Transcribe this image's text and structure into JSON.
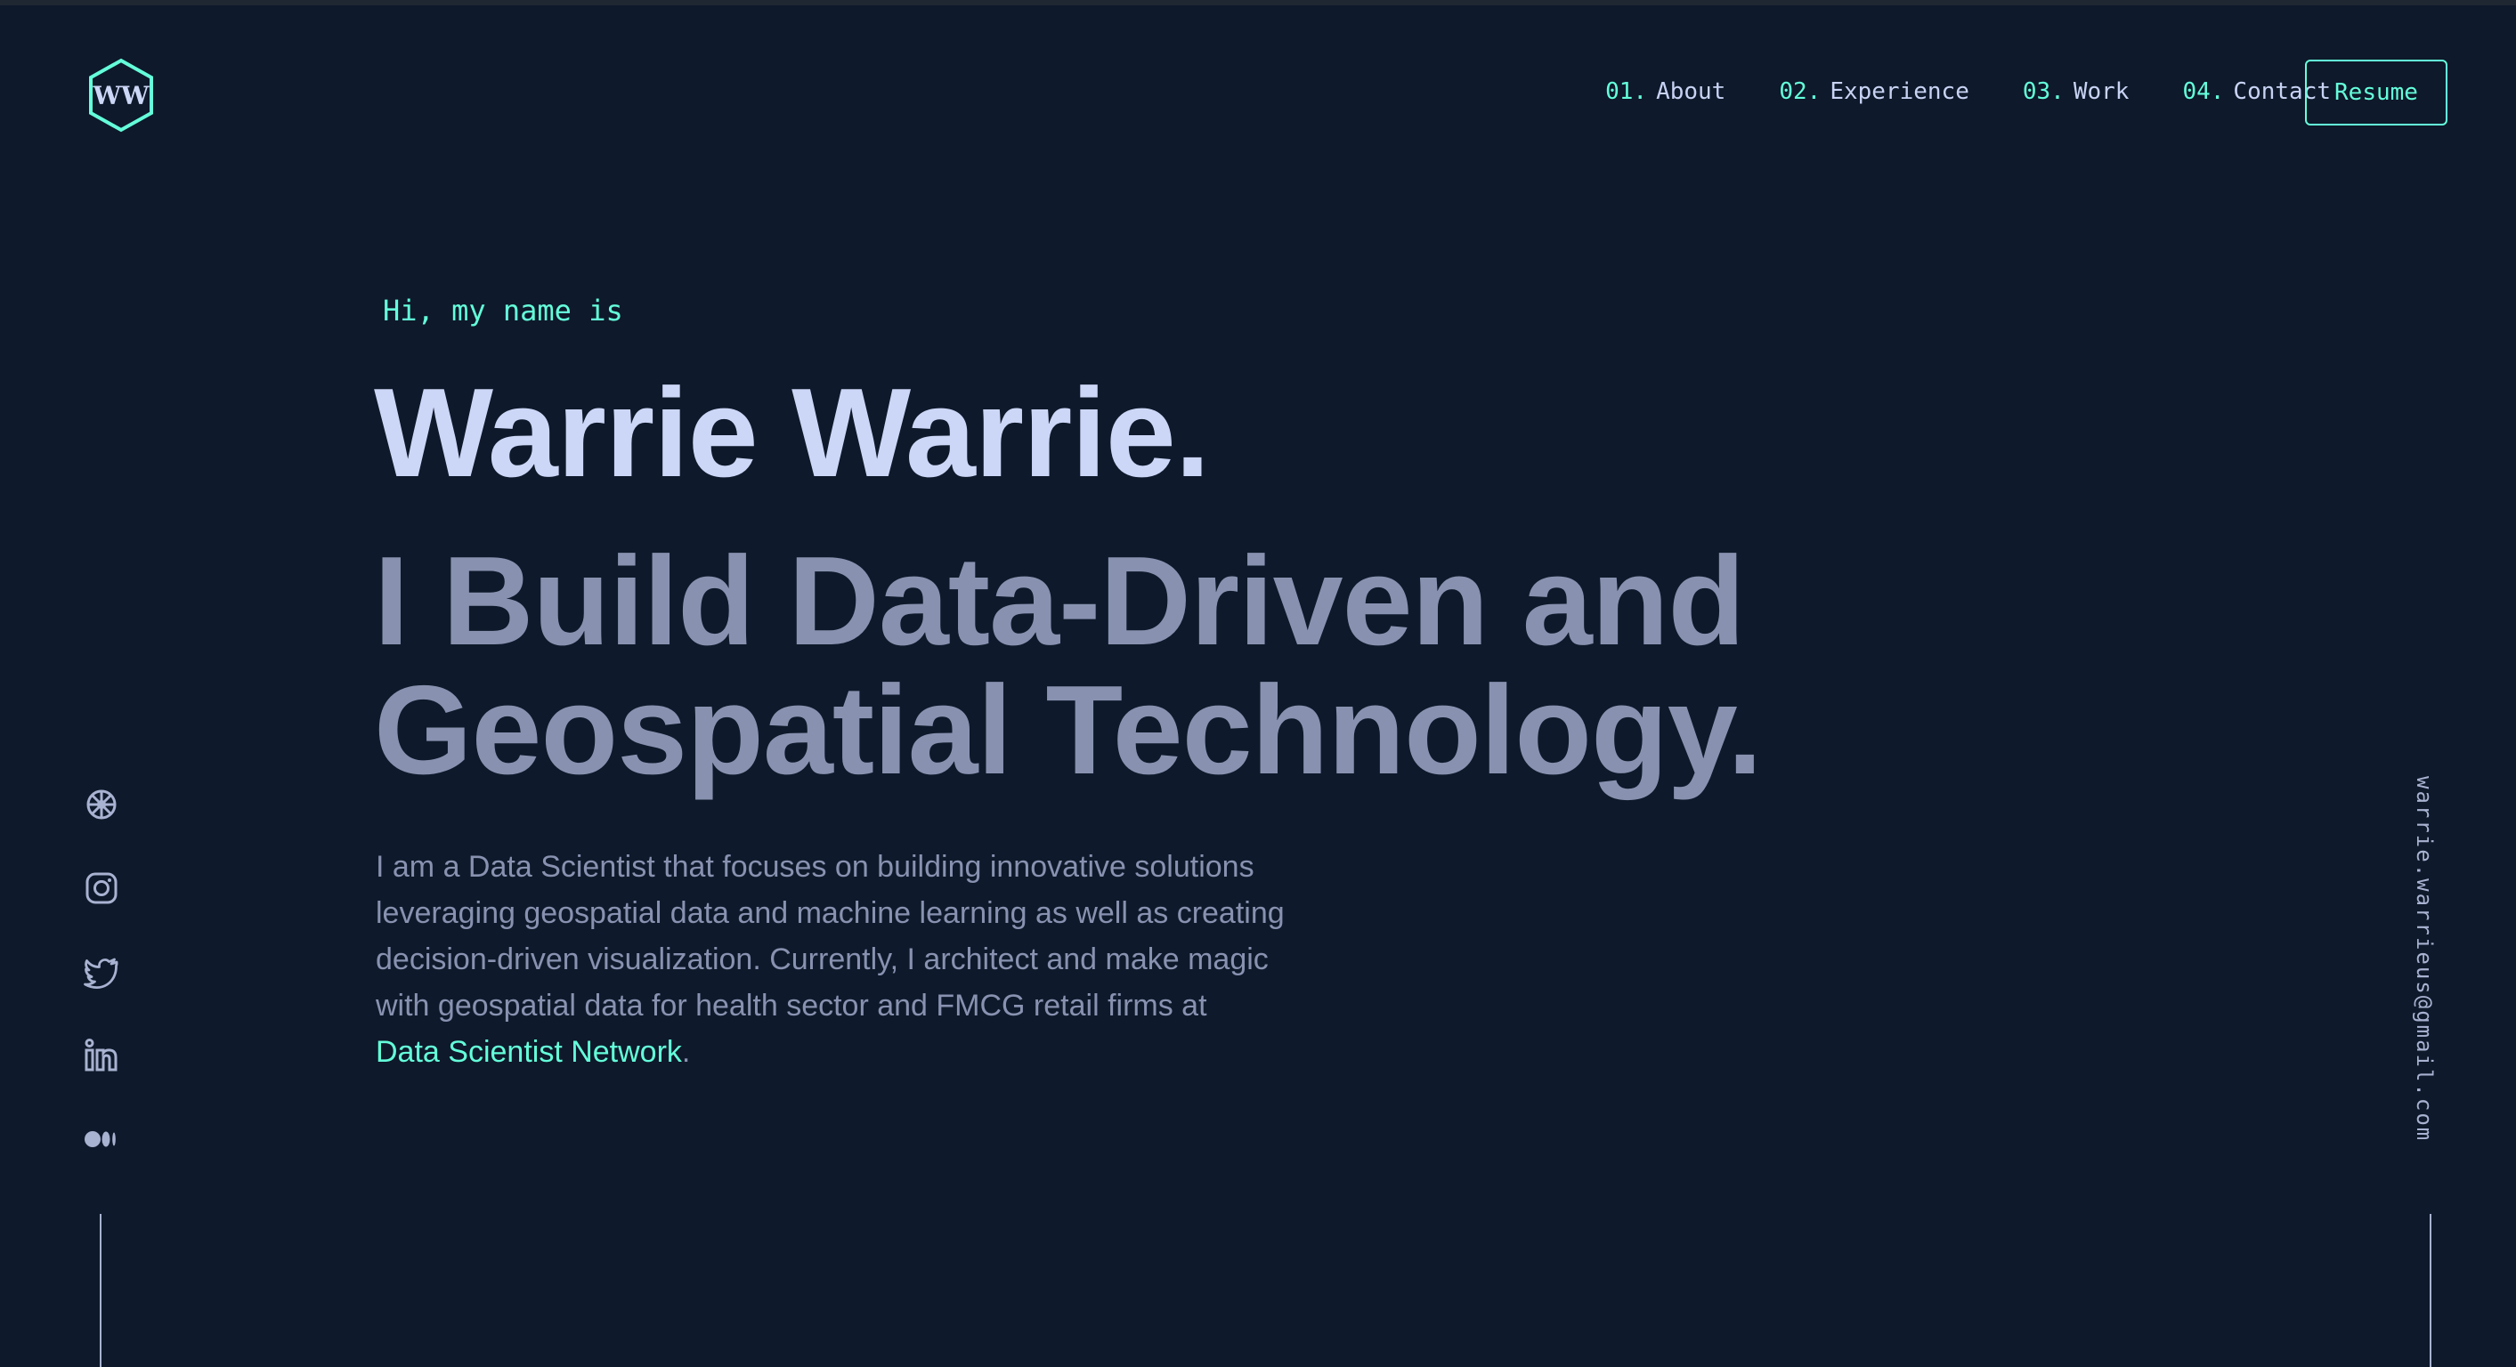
{
  "brand": {
    "logo_text": "WW",
    "accent_color": "#64ffda",
    "background_color": "#0e192b"
  },
  "nav": {
    "items": [
      {
        "number": "01.",
        "label": "About"
      },
      {
        "number": "02.",
        "label": "Experience"
      },
      {
        "number": "03.",
        "label": "Work"
      },
      {
        "number": "04.",
        "label": "Contact"
      }
    ],
    "resume_label": "Resume"
  },
  "hero": {
    "greeting": "Hi, my name is",
    "name": "Warrie Warrie.",
    "tagline_line1": "I Build Data-Driven and",
    "tagline_line2": "Geospatial Technology.",
    "description_line1": "I am a Data Scientist that focuses on building innovative solutions",
    "description_line2": "leveraging geospatial data and machine learning as well as creating",
    "description_line3": "decision-driven visualization. Currently, I architect and make magic",
    "description_line4": "with geospatial data for health sector and FMCG retail firms at",
    "link_text": "Data Scientist Network",
    "link_suffix": "."
  },
  "social": {
    "icons": [
      "network-icon",
      "instagram-icon",
      "twitter-icon",
      "linkedin-icon",
      "medium-icon"
    ]
  },
  "email": "warrie.warrieus@gmail.com"
}
